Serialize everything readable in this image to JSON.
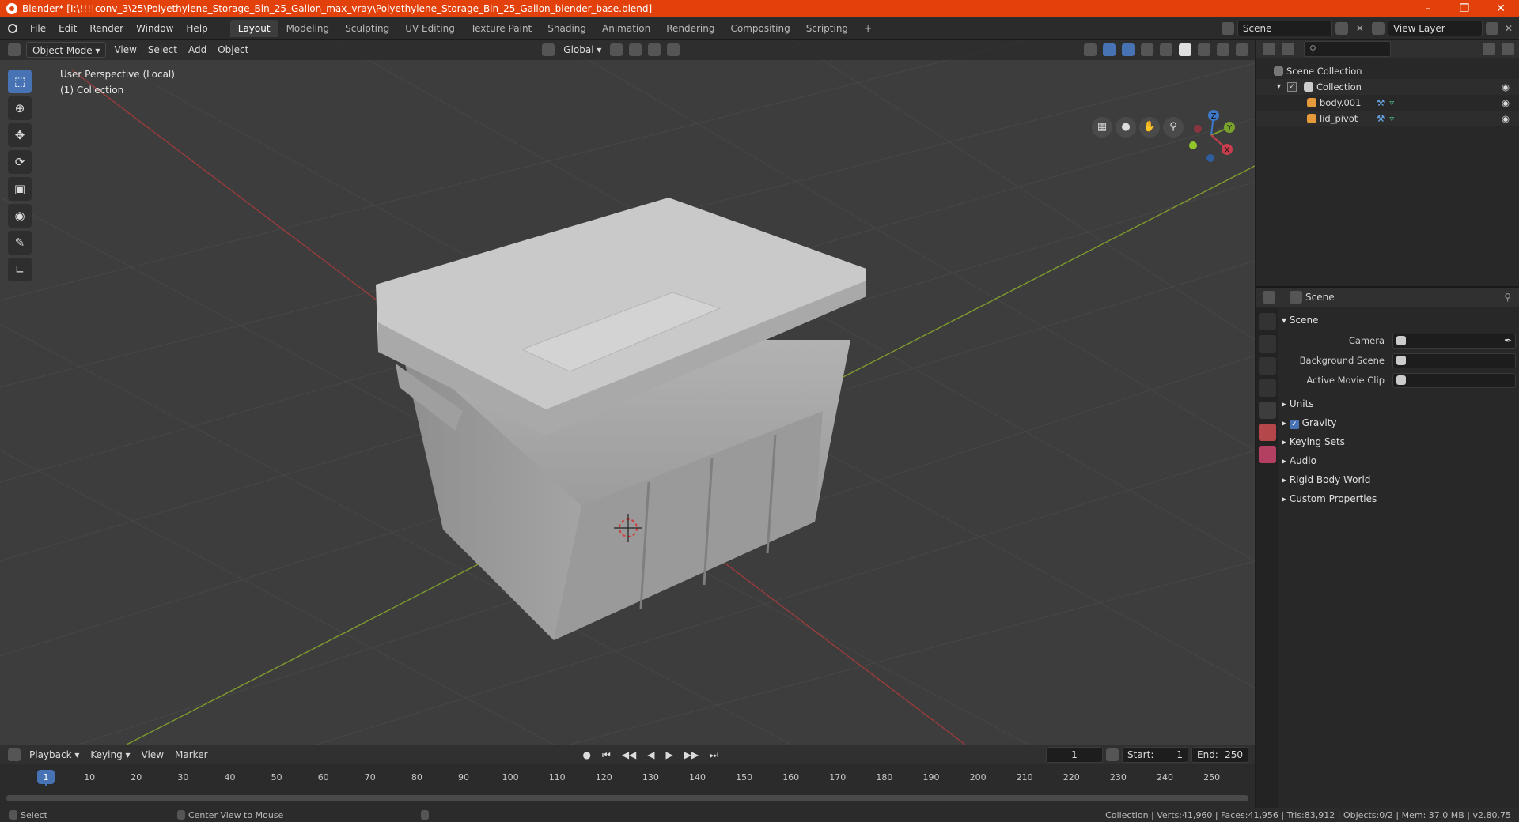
{
  "window": {
    "title": "Blender* [I:\\!!!!conv_3\\25\\Polyethylene_Storage_Bin_25_Gallon_max_vray\\Polyethylene_Storage_Bin_25_Gallon_blender_base.blend]"
  },
  "menu": [
    "File",
    "Edit",
    "Render",
    "Window",
    "Help"
  ],
  "workspaces": [
    "Layout",
    "Modeling",
    "Sculpting",
    "UV Editing",
    "Texture Paint",
    "Shading",
    "Animation",
    "Rendering",
    "Compositing",
    "Scripting"
  ],
  "active_workspace": "Layout",
  "scene_field": "Scene",
  "view_layer_field": "View Layer",
  "viewport": {
    "mode": "Object Mode",
    "menus": [
      "View",
      "Select",
      "Add",
      "Object"
    ],
    "transform_orientation": "Global",
    "info_line1": "User Perspective (Local)",
    "info_line2": "(1) Collection",
    "gizmo": {
      "z": "Z",
      "y": "Y",
      "x": "X"
    },
    "colors": {
      "x_axis": "#9b3b3b",
      "y_axis": "#7e9b2e",
      "bg": "#3d3d3d"
    }
  },
  "timeline": {
    "menus": [
      "Playback",
      "Keying",
      "View",
      "Marker"
    ],
    "current_frame": "1",
    "start_label": "Start:",
    "start": "1",
    "end_label": "End:",
    "end": "250",
    "ticks": [
      "1",
      "10",
      "20",
      "30",
      "40",
      "50",
      "60",
      "70",
      "80",
      "90",
      "100",
      "110",
      "120",
      "130",
      "140",
      "150",
      "160",
      "170",
      "180",
      "190",
      "200",
      "210",
      "220",
      "230",
      "240",
      "250"
    ]
  },
  "outliner": {
    "scene_collection": "Scene Collection",
    "collection": "Collection",
    "objects": [
      "body.001",
      "lid_pivot"
    ]
  },
  "properties": {
    "header": "Scene",
    "section": "Scene",
    "camera_label": "Camera",
    "background_scene_label": "Background Scene",
    "active_movie_clip_label": "Active Movie Clip",
    "subsections": [
      "Units",
      "Gravity",
      "Keying Sets",
      "Audio",
      "Rigid Body World",
      "Custom Properties"
    ]
  },
  "status": {
    "select": "Select",
    "center_view": "Center View to Mouse",
    "stats": "Collection | Verts:41,960 | Faces:41,956 | Tris:83,912 | Objects:0/2 | Mem: 37.0 MB | v2.80.75"
  }
}
